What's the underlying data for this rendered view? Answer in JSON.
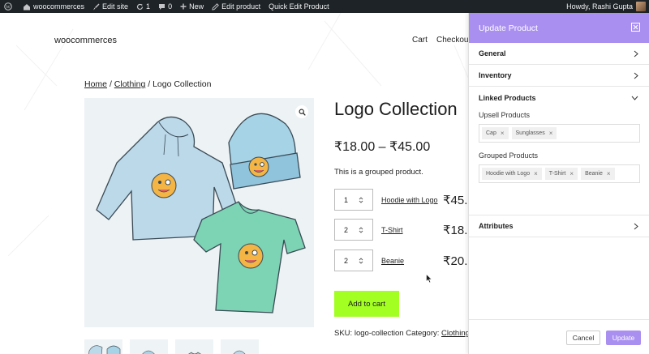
{
  "admin_bar": {
    "site_name": "woocommerces",
    "edit_site": "Edit site",
    "updates_count": "1",
    "comments_count": "0",
    "new_label": "New",
    "edit_product": "Edit product",
    "quick_edit": "Quick Edit Product",
    "howdy": "Howdy, Rashi Gupta"
  },
  "site": {
    "title": "woocommerces",
    "nav": [
      "Cart",
      "Checkout"
    ],
    "breadcrumb": {
      "home": "Home",
      "sep": "/",
      "category": "Clothing",
      "current": "Logo Collection"
    },
    "product": {
      "title": "Logo Collection",
      "price": "₹18.00 – ₹45.00",
      "description": "This is a grouped product.",
      "grouped_items": [
        {
          "qty": "1",
          "name": "Hoodie with Logo",
          "price": "₹45."
        },
        {
          "qty": "2",
          "name": "T-Shirt",
          "price": "₹18.0"
        },
        {
          "qty": "2",
          "name": "Beanie",
          "price": "₹20."
        }
      ],
      "add_to_cart": "Add to cart",
      "sku_label": "SKU:",
      "sku": "logo-collection",
      "category_label": "Category:",
      "category": "Clothing"
    }
  },
  "panel": {
    "title": "Update Product",
    "sections": {
      "general": "General",
      "inventory": "Inventory",
      "linked": "Linked Products",
      "attributes": "Attributes"
    },
    "upsell_label": "Upsell Products",
    "upsell_tokens": [
      "Cap",
      "Sunglasses"
    ],
    "grouped_label": "Grouped Products",
    "grouped_tokens": [
      "Hoodie with Logo",
      "T-Shirt",
      "Beanie"
    ],
    "cancel": "Cancel",
    "update": "Update"
  },
  "colors": {
    "accent": "#a98ff0",
    "cart_button": "#a2ff21",
    "admin_bar": "#1d2327"
  }
}
